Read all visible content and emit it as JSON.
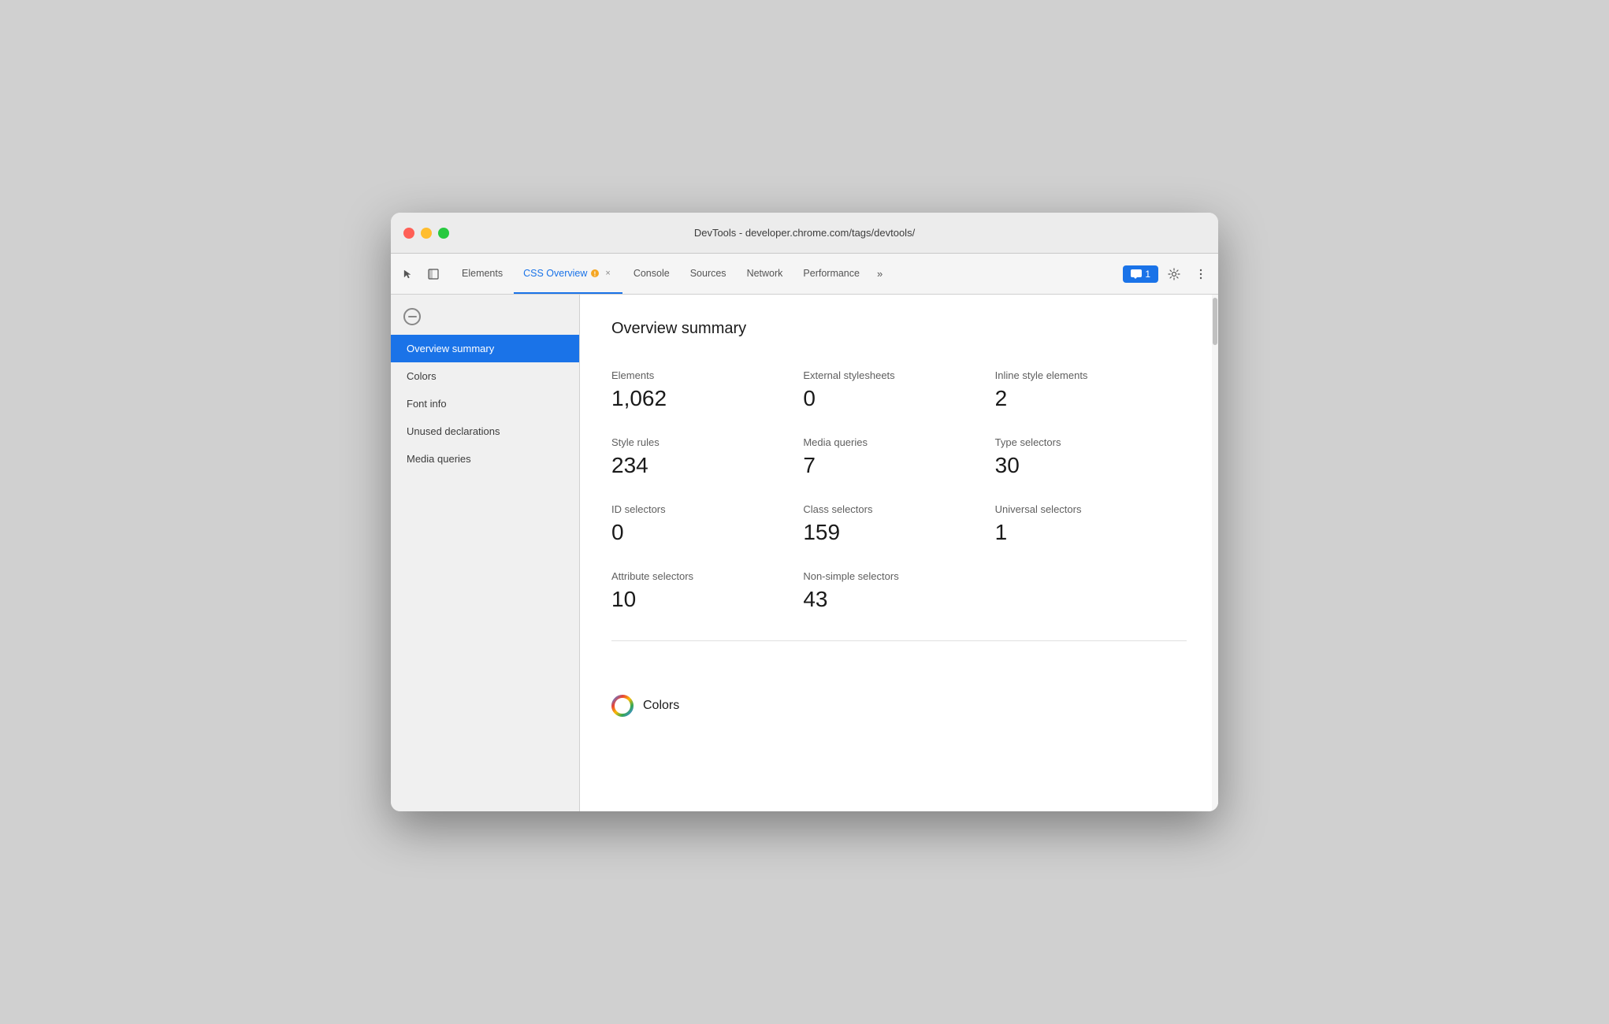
{
  "window": {
    "title": "DevTools - developer.chrome.com/tags/devtools/"
  },
  "traffic_lights": {
    "red": "red",
    "yellow": "yellow",
    "green": "green"
  },
  "tabs": [
    {
      "id": "elements",
      "label": "Elements",
      "active": false,
      "closeable": false
    },
    {
      "id": "css-overview",
      "label": "CSS Overview",
      "active": true,
      "closeable": true
    },
    {
      "id": "console",
      "label": "Console",
      "active": false,
      "closeable": false
    },
    {
      "id": "sources",
      "label": "Sources",
      "active": false,
      "closeable": false
    },
    {
      "id": "network",
      "label": "Network",
      "active": false,
      "closeable": false
    },
    {
      "id": "performance",
      "label": "Performance",
      "active": false,
      "closeable": false
    }
  ],
  "tab_more": "»",
  "toolbar": {
    "chat_count": "1",
    "chat_label": "1"
  },
  "sidebar": {
    "items": [
      {
        "id": "overview-summary",
        "label": "Overview summary",
        "active": true
      },
      {
        "id": "colors",
        "label": "Colors",
        "active": false
      },
      {
        "id": "font-info",
        "label": "Font info",
        "active": false
      },
      {
        "id": "unused-declarations",
        "label": "Unused declarations",
        "active": false
      },
      {
        "id": "media-queries",
        "label": "Media queries",
        "active": false
      }
    ]
  },
  "content": {
    "page_title": "Overview summary",
    "stats": [
      {
        "label": "Elements",
        "value": "1,062"
      },
      {
        "label": "External stylesheets",
        "value": "0"
      },
      {
        "label": "Inline style elements",
        "value": "2"
      },
      {
        "label": "Style rules",
        "value": "234"
      },
      {
        "label": "Media queries",
        "value": "7"
      },
      {
        "label": "Type selectors",
        "value": "30"
      },
      {
        "label": "ID selectors",
        "value": "0"
      },
      {
        "label": "Class selectors",
        "value": "159"
      },
      {
        "label": "Universal selectors",
        "value": "1"
      },
      {
        "label": "Attribute selectors",
        "value": "10"
      },
      {
        "label": "Non-simple selectors",
        "value": "43"
      }
    ],
    "colors_section_label": "Colors"
  }
}
